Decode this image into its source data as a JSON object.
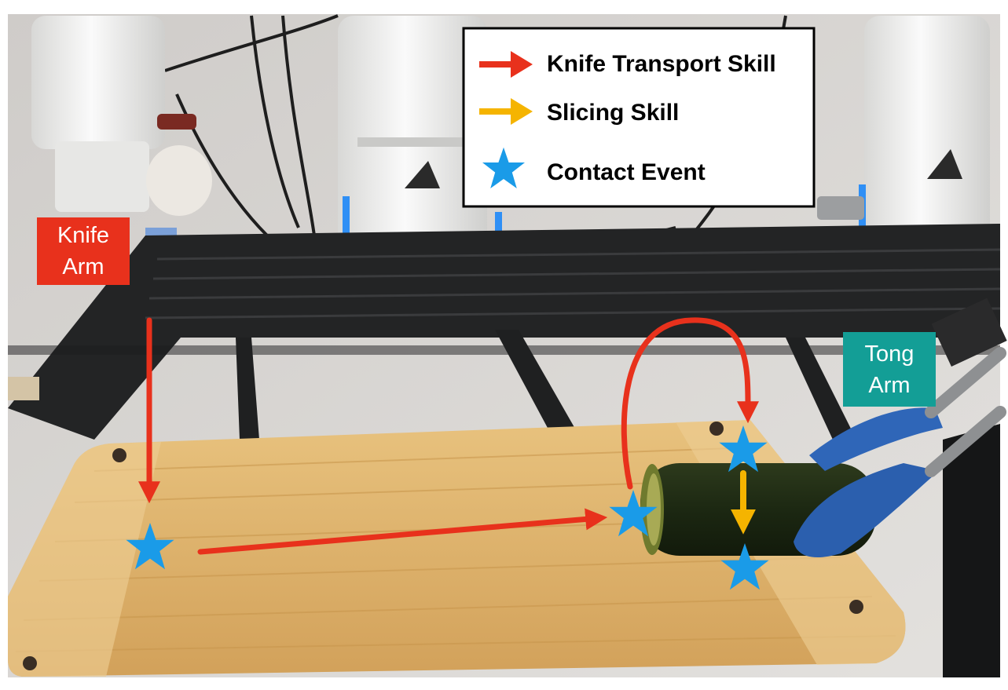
{
  "labels": {
    "knife_arm": "Knife\nArm",
    "tong_arm": "Tong\nArm"
  },
  "legend": {
    "items": [
      {
        "label": "Knife Transport Skill",
        "icon": "red-arrow-icon",
        "color": "#e8311c"
      },
      {
        "label": "Slicing Skill",
        "icon": "yellow-arrow-icon",
        "color": "#f5b400"
      },
      {
        "label": "Contact Event",
        "icon": "blue-star-icon",
        "color": "#1a9be8"
      }
    ]
  },
  "colors": {
    "knife_transport": "#e8311c",
    "slicing": "#f5b400",
    "contact_event": "#1a9be8",
    "knife_label_bg": "#e8311c",
    "tong_label_bg": "#139e96"
  }
}
